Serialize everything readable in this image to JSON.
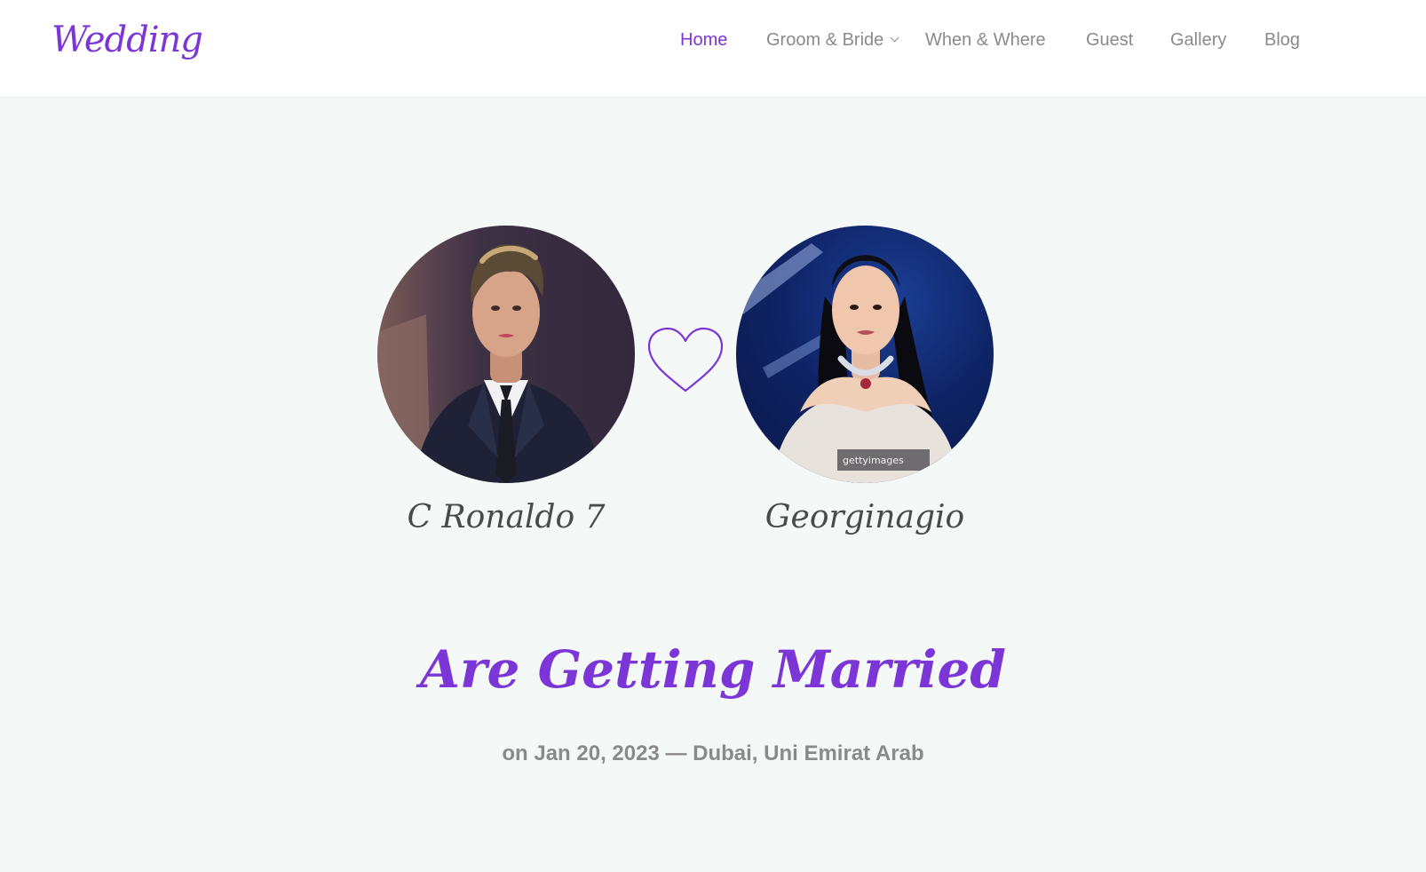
{
  "header": {
    "logo": "Wedding",
    "nav": [
      {
        "label": "Home",
        "active": true
      },
      {
        "label": "Groom & Bride",
        "dropdown": true
      },
      {
        "label": "When & Where"
      },
      {
        "label": "Guest"
      },
      {
        "label": "Gallery"
      },
      {
        "label": "Blog"
      }
    ]
  },
  "hero": {
    "groom_name": "C Ronaldo 7",
    "bride_name": "Georginagio",
    "headline": "Are Getting Married",
    "event_line": "on Jan 20, 2023 — Dubai, Uni Emirat Arab"
  },
  "colors": {
    "accent": "#7c35d6",
    "text_muted": "#8a8a8a",
    "background": "#f4f8f6"
  }
}
